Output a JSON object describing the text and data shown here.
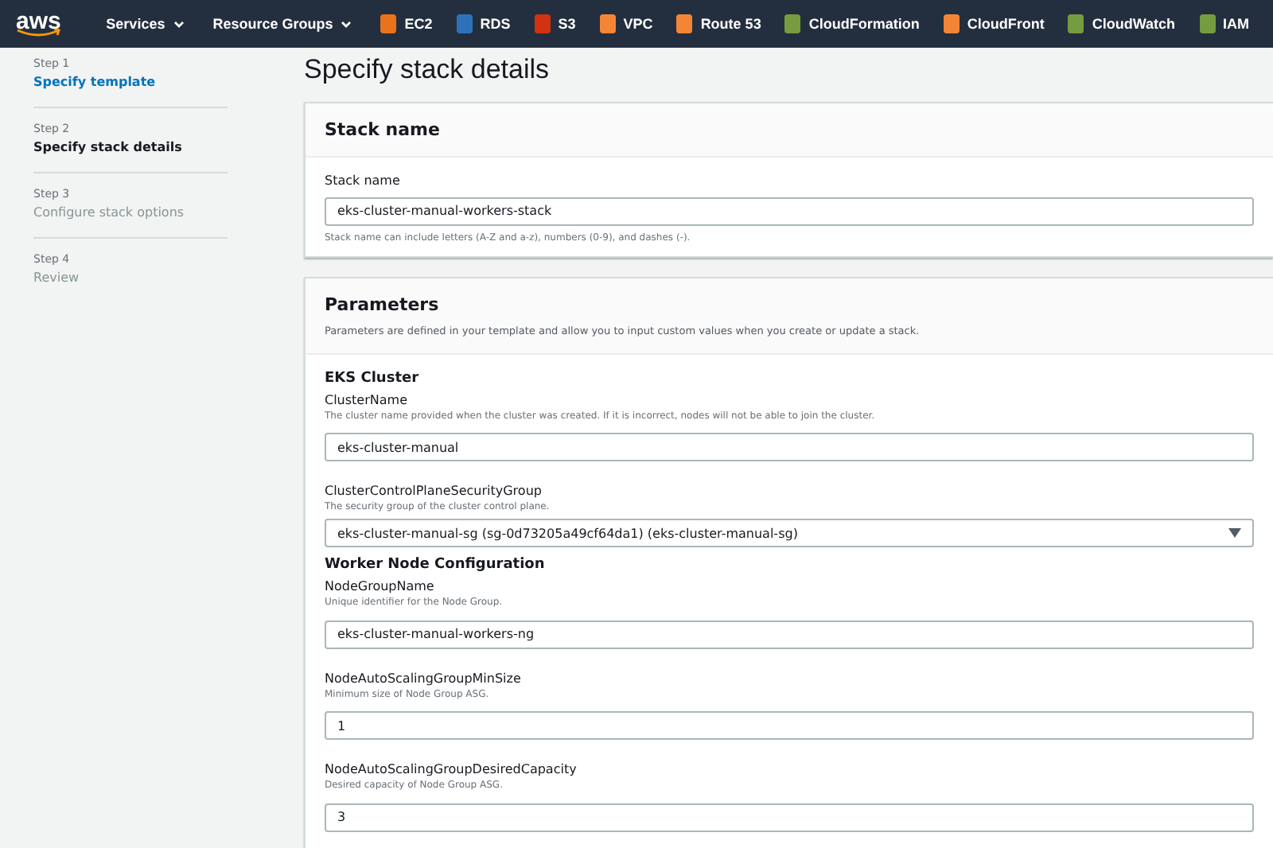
{
  "navbar": {
    "logo": "aws",
    "menus": [
      {
        "label": "Services"
      },
      {
        "label": "Resource Groups"
      }
    ],
    "services": [
      {
        "label": "EC2",
        "color": "#e8731a"
      },
      {
        "label": "RDS",
        "color": "#2d72b8"
      },
      {
        "label": "S3",
        "color": "#d13212"
      },
      {
        "label": "VPC",
        "color": "#f58536"
      },
      {
        "label": "Route 53",
        "color": "#f58536"
      },
      {
        "label": "CloudFormation",
        "color": "#759c3e"
      },
      {
        "label": "CloudFront",
        "color": "#f58536"
      },
      {
        "label": "CloudWatch",
        "color": "#759c3e"
      },
      {
        "label": "IAM",
        "color": "#759c3e"
      }
    ]
  },
  "steps": [
    {
      "step": "Step 1",
      "label": "Specify template",
      "completed": true,
      "selected": false
    },
    {
      "step": "Step 2",
      "label": "Specify stack details",
      "completed": false,
      "selected": true
    },
    {
      "step": "Step 3",
      "label": "Configure stack options",
      "completed": false,
      "selected": false
    },
    {
      "step": "Step 4",
      "label": "Review",
      "completed": false,
      "selected": false
    }
  ],
  "title": "Specify stack details",
  "stack_name_card": {
    "heading": "Stack name",
    "field": {
      "label": "Stack name",
      "value": "eks-cluster-manual-workers-stack",
      "hint": "Stack name can include letters (A-Z and a-z), numbers (0-9), and dashes (-)."
    }
  },
  "parameters_card": {
    "heading": "Parameters",
    "description": "Parameters are defined in your template and allow you to input custom values when you create or update a stack.",
    "groups": [
      {
        "title": "EKS Cluster",
        "fields": [
          {
            "kind": "text",
            "label": "ClusterName",
            "description": "The cluster name provided when the cluster was created. If it is incorrect, nodes will not be able to join the cluster.",
            "value": "eks-cluster-manual"
          },
          {
            "kind": "select",
            "label": "ClusterControlPlaneSecurityGroup",
            "description": "The security group of the cluster control plane.",
            "value": "eks-cluster-manual-sg (sg-0d73205a49cf64da1) (eks-cluster-manual-sg)"
          }
        ]
      },
      {
        "title": "Worker Node Configuration",
        "fields": [
          {
            "kind": "text",
            "label": "NodeGroupName",
            "description": "Unique identifier for the Node Group.",
            "value": "eks-cluster-manual-workers-ng"
          },
          {
            "kind": "text",
            "label": "NodeAutoScalingGroupMinSize",
            "description": "Minimum size of Node Group ASG.",
            "value": "1"
          },
          {
            "kind": "text",
            "label": "NodeAutoScalingGroupDesiredCapacity",
            "description": "Desired capacity of Node Group ASG.",
            "value": "3"
          }
        ]
      }
    ]
  }
}
